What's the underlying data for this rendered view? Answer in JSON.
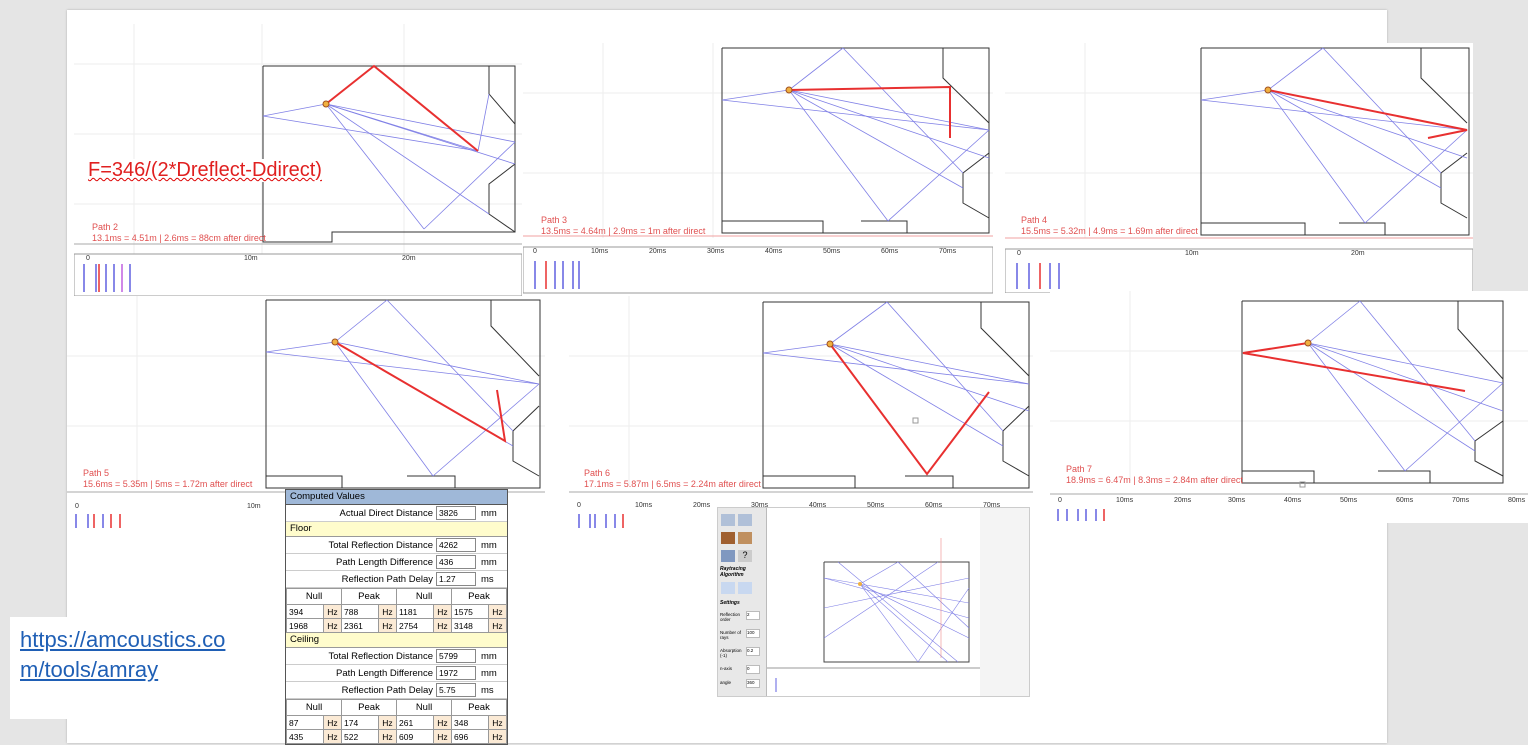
{
  "formula": "F=346/(2*Dreflect-Ddirect)",
  "link": "https://amcoustics.com/tools/amray",
  "paths": [
    {
      "label": "Path 2",
      "caption": "13.1ms = 4.51m    |    2.6ms = 88cm after direct",
      "ticks": [
        "0",
        "10m",
        "20m"
      ]
    },
    {
      "label": "Path 3",
      "caption": "13.5ms = 4.64m    |    2.9ms = 1m after direct",
      "ticks": [
        "0",
        "10ms",
        "20ms",
        "30ms",
        "40ms",
        "50ms",
        "60ms",
        "70ms"
      ]
    },
    {
      "label": "Path 4",
      "caption": "15.5ms = 5.32m    |    4.9ms = 1.69m after direct",
      "ticks": [
        "0",
        "10m",
        "20m"
      ]
    },
    {
      "label": "Path 5",
      "caption": "15.6ms = 5.35m    |    5ms = 1.72m after direct",
      "ticks": [
        "0",
        "10m"
      ]
    },
    {
      "label": "Path 6",
      "caption": "17.1ms = 5.87m    |    6.5ms = 2.24m after direct",
      "ticks": [
        "0",
        "10ms",
        "20ms",
        "30ms",
        "40ms",
        "50ms",
        "60ms",
        "70ms"
      ]
    },
    {
      "label": "Path 7",
      "caption": "18.9ms = 6.47m    |    8.3ms = 2.84m after direct",
      "ticks": [
        "0",
        "10ms",
        "20ms",
        "30ms",
        "40ms",
        "50ms",
        "60ms",
        "70ms",
        "80ms"
      ]
    }
  ],
  "computed": {
    "title": "Computed Values",
    "direct_label": "Actual Direct Distance",
    "direct_value": "3826",
    "direct_unit": "mm",
    "floor": {
      "title": "Floor",
      "rows": [
        {
          "label": "Total Reflection Distance",
          "value": "4262",
          "unit": "mm"
        },
        {
          "label": "Path Length Difference",
          "value": "436",
          "unit": "mm"
        },
        {
          "label": "Reflection Path Delay",
          "value": "1.27",
          "unit": "ms"
        }
      ],
      "headers": [
        "Null",
        "Peak",
        "Null",
        "Peak"
      ],
      "cells": [
        [
          "394",
          "788",
          "1181",
          "1575"
        ],
        [
          "1968",
          "2361",
          "2754",
          "3148"
        ]
      ]
    },
    "ceiling": {
      "title": "Ceiling",
      "rows": [
        {
          "label": "Total Reflection Distance",
          "value": "5799",
          "unit": "mm"
        },
        {
          "label": "Path Length Difference",
          "value": "1972",
          "unit": "mm"
        },
        {
          "label": "Reflection Path Delay",
          "value": "5.75",
          "unit": "ms"
        }
      ],
      "headers": [
        "Null",
        "Peak",
        "Null",
        "Peak"
      ],
      "cells": [
        [
          "87",
          "174",
          "261",
          "348"
        ],
        [
          "435",
          "522",
          "609",
          "696"
        ]
      ]
    },
    "hz": "Hz"
  },
  "app": {
    "sidebar": [
      "Raytracing Algorithm",
      "Settings",
      "Reflection order",
      "Number of rays",
      "Absorption (-1)",
      "n-axis",
      "angle"
    ],
    "values": [
      "2",
      "100",
      "0.2",
      "0",
      "360"
    ]
  },
  "colors": {
    "ray": "#7a7ae8",
    "highlight": "#e83030",
    "caption": "#e05050",
    "link": "#1f5fb5"
  }
}
